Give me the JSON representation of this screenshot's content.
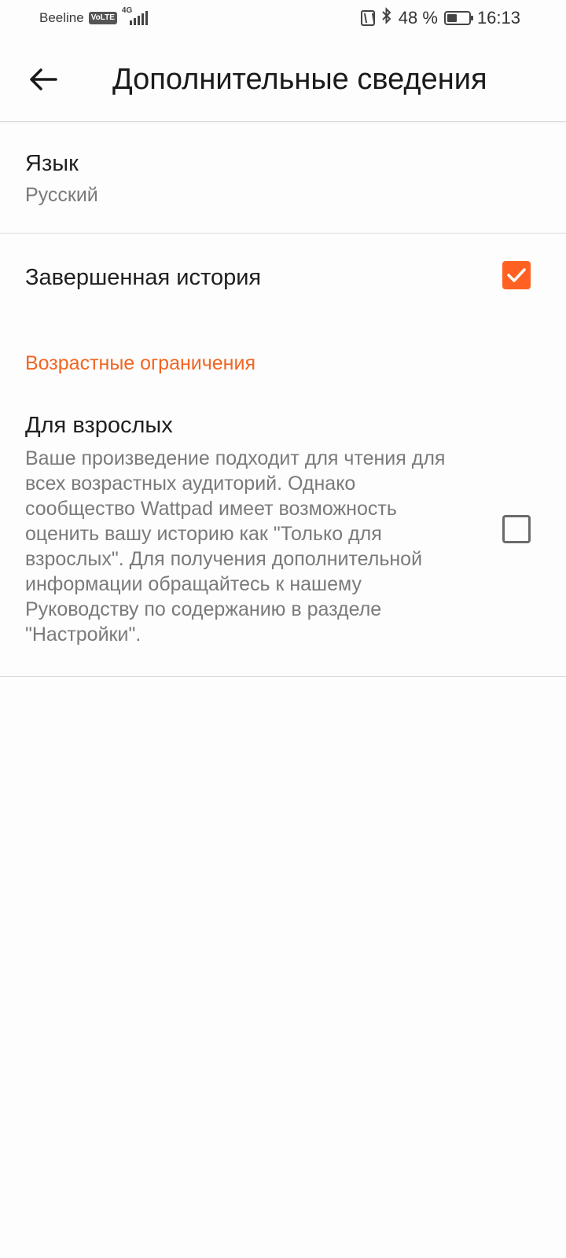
{
  "status_bar": {
    "carrier": "Beeline",
    "volte": "VoLTE",
    "network": "4G",
    "battery_percent": "48 %",
    "battery_level": 0.48,
    "time": "16:13",
    "icons": [
      "nfc-icon",
      "bluetooth-icon",
      "battery-icon"
    ]
  },
  "app_bar": {
    "back_icon": "arrow-left-icon",
    "title": "Дополнительные сведения"
  },
  "language": {
    "label": "Язык",
    "value": "Русский"
  },
  "completed": {
    "label": "Завершенная история",
    "checked": true
  },
  "age_section": {
    "header": "Возрастные ограничения",
    "adult_label": "Для взрослых",
    "adult_description": "Ваше произведение подходит для чтения для всех возрастных аудиторий. Однако сообщество Wattpad имеет возможность оценить вашу историю как \"Только для взрослых\". Для получения дополнительной информации обращайтесь к нашему Руководству по содержанию в разделе \"Настройки\".",
    "adult_checked": false
  },
  "colors": {
    "accent": "#ff6122",
    "section_header": "#f26522",
    "secondary_text": "#7a7a7a"
  }
}
